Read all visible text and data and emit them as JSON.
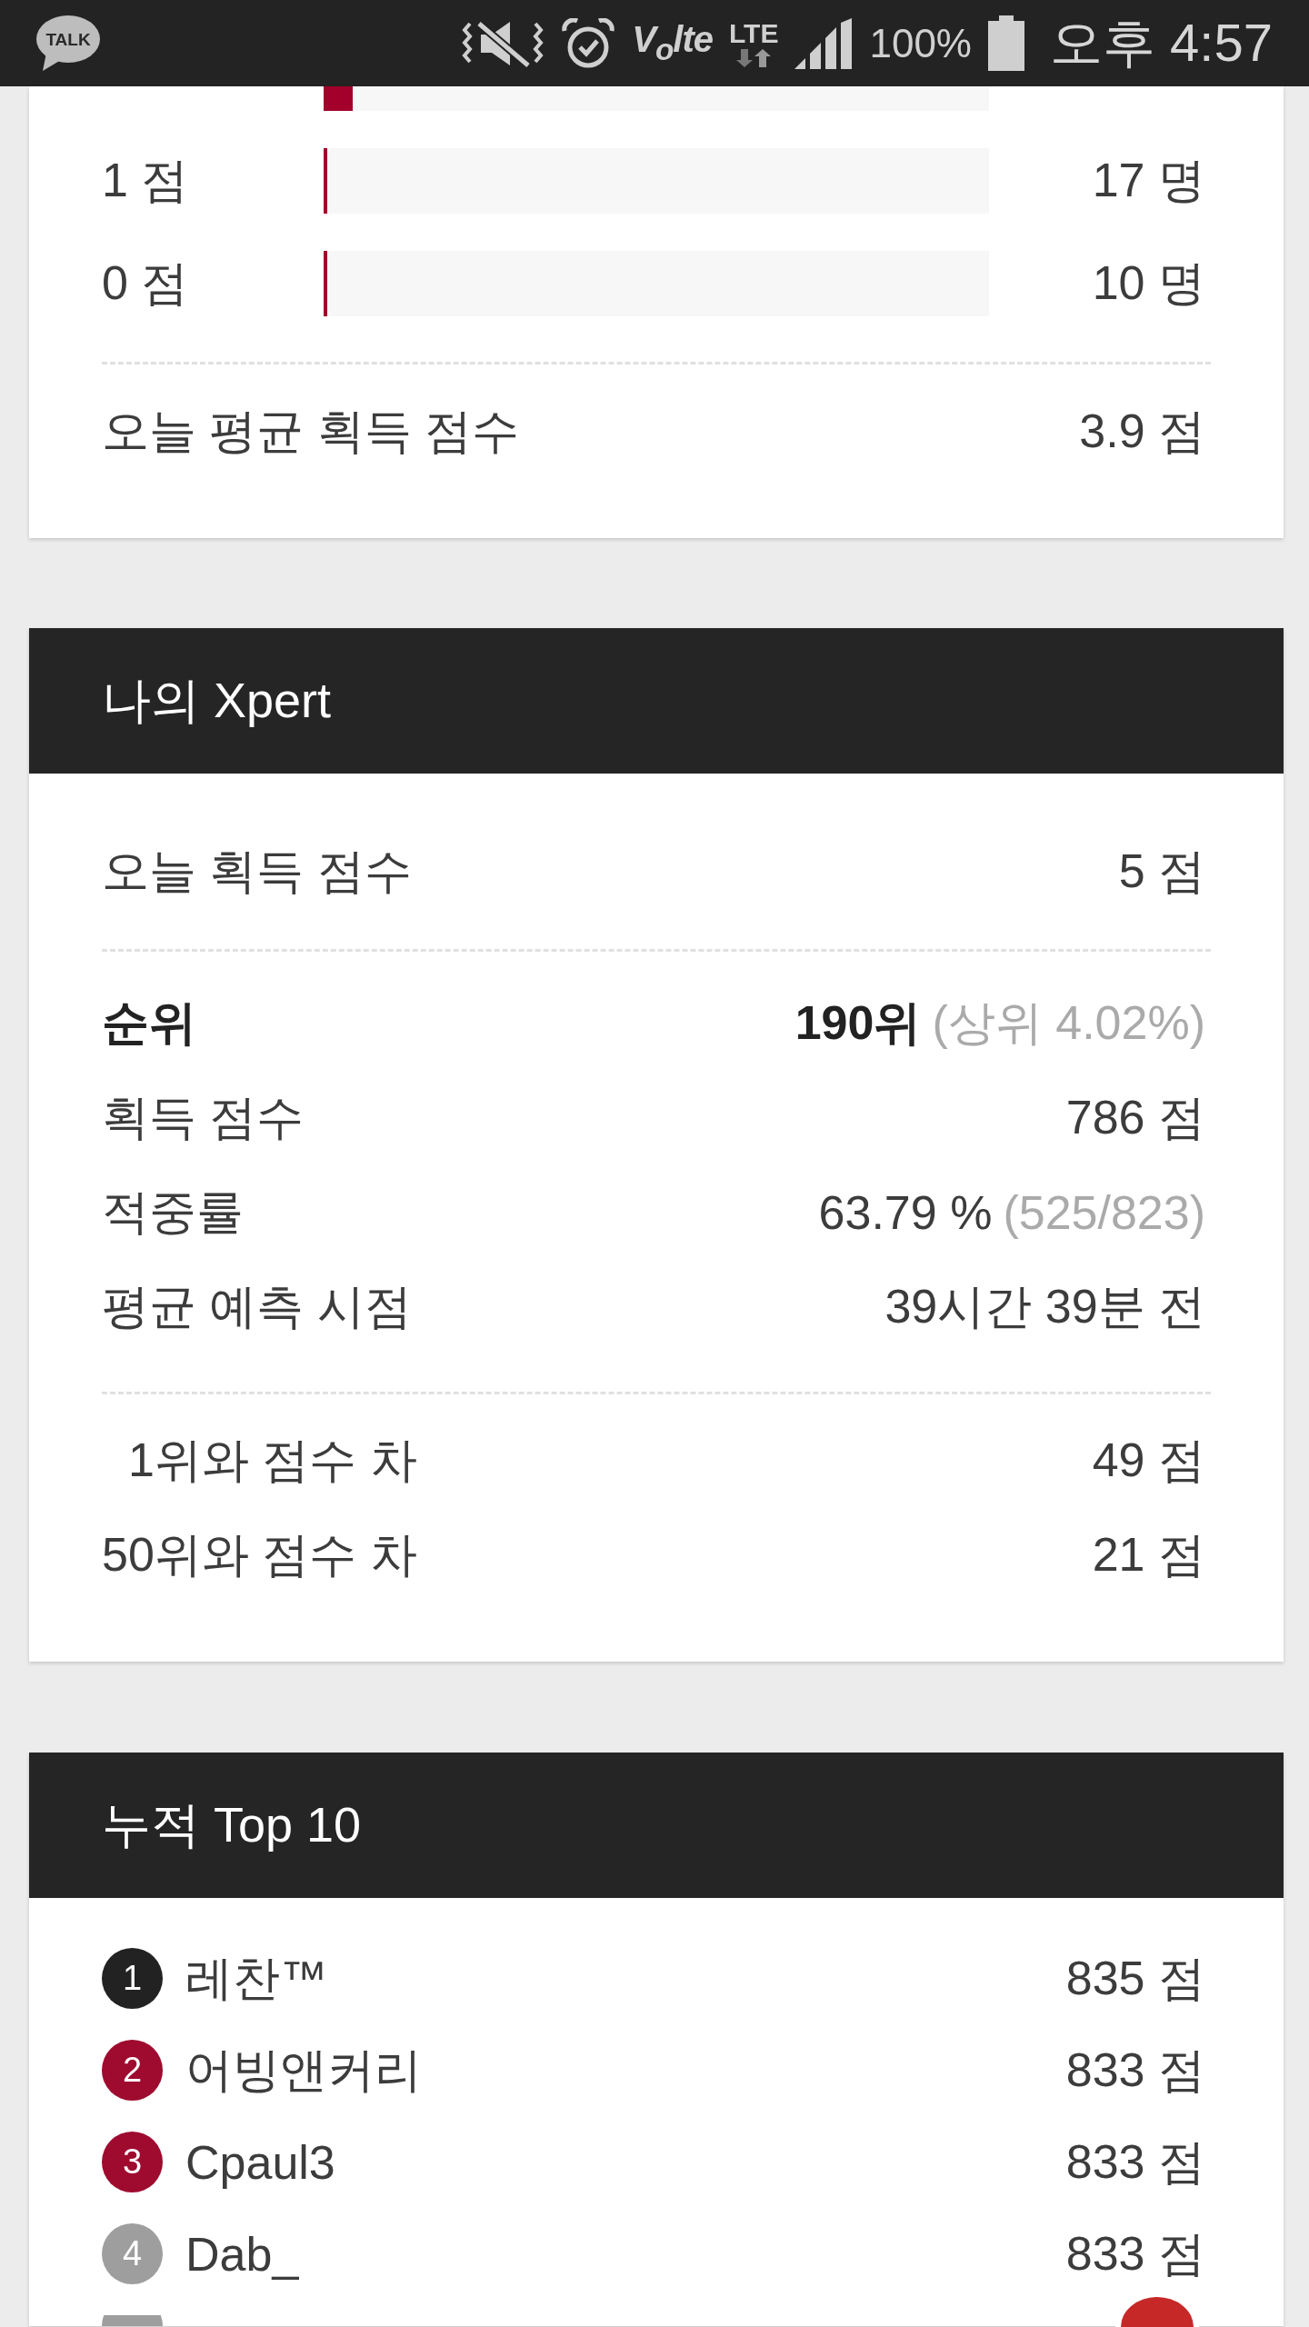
{
  "status_bar": {
    "app_badge": "TALK",
    "volte": "V$_{o}$lte",
    "network": "LTE",
    "battery": "100%",
    "time": "오후 4:57"
  },
  "score_distribution": {
    "rows": [
      {
        "kind": "cut",
        "level": 0.044
      },
      {
        "kind": "full",
        "label": "1 점",
        "count": "17 명",
        "level": 0.006
      },
      {
        "kind": "full",
        "label": "0 점",
        "count": "10 명",
        "level": 0.006
      }
    ],
    "average": {
      "label": "오늘 평균 획득 점수",
      "value": "3.9 점"
    }
  },
  "my_xpert": {
    "title": "나의 Xpert",
    "today": {
      "label": "오늘 획득 점수",
      "value": "5 점"
    },
    "stats": [
      {
        "label": "순위",
        "value": "190위",
        "note": "(상위 4.02%)",
        "emphasized": true
      },
      {
        "label": "획득 점수",
        "value": "786 점",
        "emphasized": false
      },
      {
        "label": "적중률",
        "value": "63.79 %",
        "note": "(525/823)",
        "emphasized": false
      },
      {
        "label": "평균 예측 시점",
        "value": "39시간 39분 전",
        "emphasized": false
      }
    ],
    "gaps": [
      {
        "label": "  1위와 점수 차",
        "value": "49 점"
      },
      {
        "label": "50위와 점수 차",
        "value": "21 점"
      }
    ]
  },
  "top10": {
    "title": "누적 Top 10",
    "rows": [
      {
        "kind": "full",
        "rank": "1",
        "name": "레찬™",
        "score": "835 점",
        "color": "#222222"
      },
      {
        "kind": "full",
        "rank": "2",
        "name": "어빙앤커리",
        "score": "833 점",
        "color": "#9e0b2f"
      },
      {
        "kind": "full",
        "rank": "3",
        "name": "Cpaul3",
        "score": "833 점",
        "color": "#9e0b2f"
      },
      {
        "kind": "full",
        "rank": "4",
        "name": "Dab_",
        "score": "833 점",
        "color": "#9e9e9e"
      },
      {
        "kind": "cut",
        "color": "#9e9e9e"
      }
    ]
  }
}
